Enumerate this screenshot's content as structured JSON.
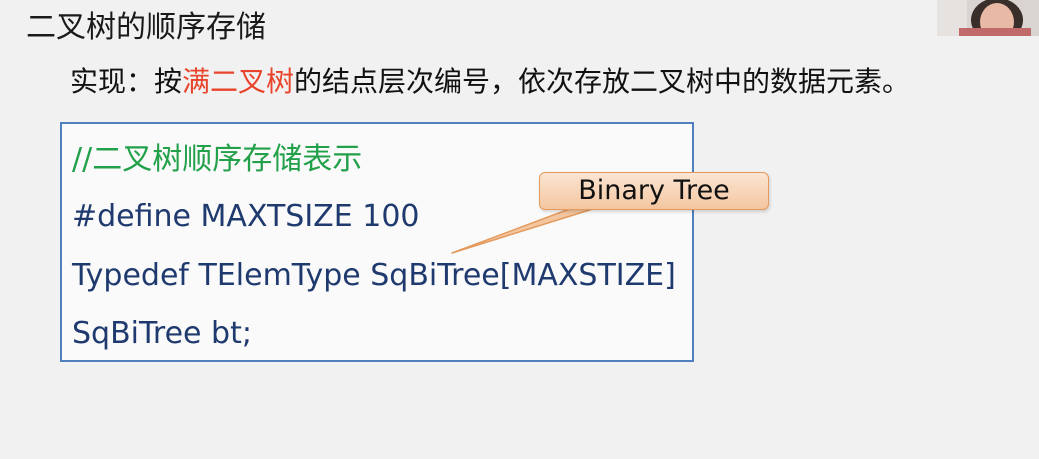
{
  "slide": {
    "title": "二叉树的顺序存储",
    "subtitle": {
      "prefix": "实现：按",
      "highlight": "满二叉树",
      "suffix": "的结点层次编号，依次存放二叉树中的数据元素。"
    }
  },
  "code": {
    "comment": "//二叉树顺序存储表示",
    "define": "#define MAXTSIZE 100",
    "typedef": "Typedef TElemType SqBiTree[MAXSTIZE]",
    "decl": "SqBiTree bt;"
  },
  "callout": {
    "label": "Binary Tree"
  },
  "colors": {
    "highlight": "#e8442c",
    "comment": "#22a04a",
    "code": "#1f3a6e",
    "box_border": "#4f7fbc",
    "callout_fill": "#f4c6a0"
  }
}
